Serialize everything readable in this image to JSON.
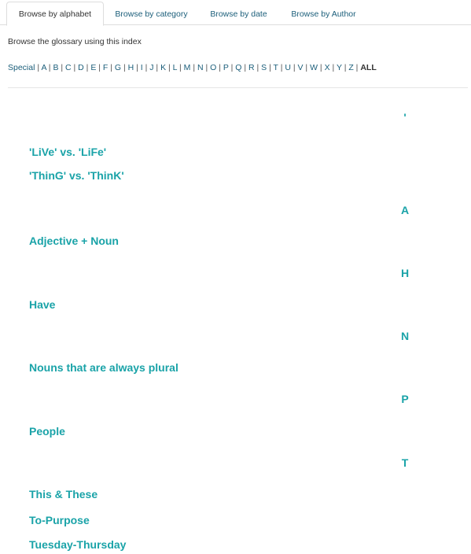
{
  "tabs": [
    {
      "label": "Browse by alphabet",
      "active": true
    },
    {
      "label": "Browse by category",
      "active": false
    },
    {
      "label": "Browse by date",
      "active": false
    },
    {
      "label": "Browse by Author",
      "active": false
    }
  ],
  "intro": "Browse the glossary using this index",
  "alphabet": {
    "special": "Special",
    "letters": [
      "A",
      "B",
      "C",
      "D",
      "E",
      "F",
      "G",
      "H",
      "I",
      "J",
      "K",
      "L",
      "M",
      "N",
      "O",
      "P",
      "Q",
      "R",
      "S",
      "T",
      "U",
      "V",
      "W",
      "X",
      "Y",
      "Z"
    ],
    "all": "ALL",
    "separator": "|"
  },
  "groups": [
    {
      "letter": "'",
      "entries": [
        "'LiVe' vs. 'LiFe'",
        "'ThinG' vs. 'ThinK'"
      ]
    },
    {
      "letter": "A",
      "entries": [
        "Adjective + Noun"
      ]
    },
    {
      "letter": "H",
      "entries": [
        "Have"
      ]
    },
    {
      "letter": "N",
      "entries": [
        "Nouns that are always plural"
      ]
    },
    {
      "letter": "P",
      "entries": [
        "People"
      ]
    },
    {
      "letter": "T",
      "entries": [
        "This & These",
        "To-Purpose",
        "Tuesday-Thursday"
      ]
    }
  ],
  "colors": {
    "accent": "#1aa3a8",
    "link": "#1b5e7a",
    "text": "#333333",
    "border": "#dddddd"
  }
}
